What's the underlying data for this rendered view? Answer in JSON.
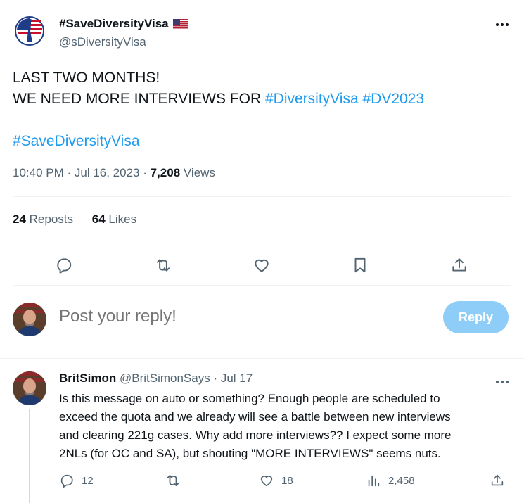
{
  "tweet": {
    "display_name": "#SaveDiversityVisa",
    "handle": "@sDiversityVisa",
    "text_lines": [
      [
        {
          "t": "LAST TWO MONTHS!",
          "tag": false
        }
      ],
      [
        {
          "t": "WE NEED MORE INTERVIEWS FOR ",
          "tag": false
        },
        {
          "t": "#DiversityVisa",
          "tag": true
        },
        {
          "t": " ",
          "tag": false
        },
        {
          "t": "#DV2023",
          "tag": true
        }
      ],
      [],
      [
        {
          "t": "#SaveDiversityVisa",
          "tag": true
        }
      ]
    ],
    "time": "10:40 PM",
    "separator": " · ",
    "date": "Jul 16, 2023",
    "views_count": "7,208",
    "views_label": " Views",
    "reposts_count": "24",
    "reposts_label": " Reposts",
    "likes_count": "64",
    "likes_label": " Likes",
    "action_icons": [
      "reply-icon",
      "repost-icon",
      "like-icon",
      "bookmark-icon",
      "share-icon"
    ]
  },
  "composer": {
    "placeholder": "Post your reply!",
    "button_label": "Reply"
  },
  "reply": {
    "display_name": "BritSimon",
    "handle": "@BritSimonSays",
    "separator": " · ",
    "date": "Jul 17",
    "text_lines": [
      "Is this message on auto or something?  Enough people are scheduled to",
      "exceed the quota and we already will see a battle between new interviews",
      "and clearing 221g cases. Why add more interviews?? I expect some more",
      "2NLs (for OC and SA), but shouting \"MORE INTERVIEWS\" seems nuts."
    ],
    "reply_count": "12",
    "repost_count": "",
    "like_count": "18",
    "views_count": "2,458"
  },
  "colors": {
    "accent": "#1d9bf0",
    "reply_button_disabled": "#8ecdf8",
    "secondary_text": "#536471",
    "divider": "#eff3f4"
  }
}
